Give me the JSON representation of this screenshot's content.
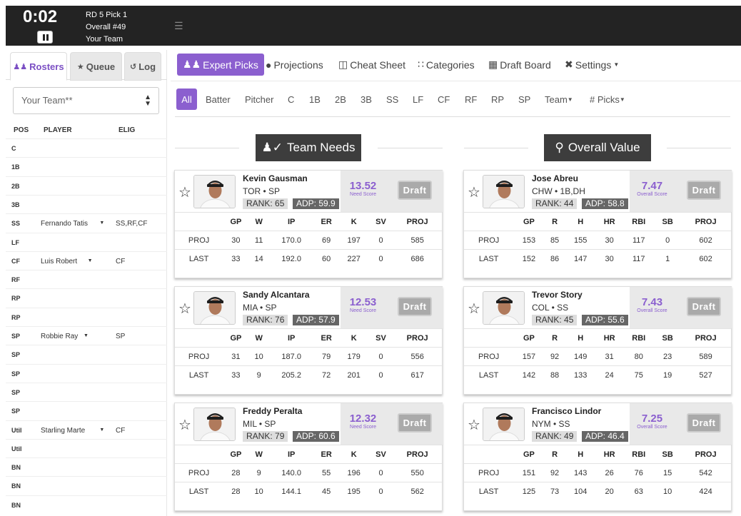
{
  "header": {
    "clock": "0:02",
    "pick_line1": "RD 5 Pick 1",
    "pick_line2": "Overall #49",
    "pick_line3": "Your Team"
  },
  "left_tabs": [
    {
      "label": "Rosters",
      "icon": "users-icon"
    },
    {
      "label": "Queue",
      "icon": "star-icon"
    },
    {
      "label": "Log",
      "icon": "history-icon"
    }
  ],
  "team_select": {
    "value": "Your Team**"
  },
  "roster_headers": {
    "pos": "POS",
    "player": "PLAYER",
    "elig": "ELIG"
  },
  "roster": [
    {
      "pos": "C",
      "player": "",
      "elig": ""
    },
    {
      "pos": "1B",
      "player": "",
      "elig": ""
    },
    {
      "pos": "2B",
      "player": "",
      "elig": ""
    },
    {
      "pos": "3B",
      "player": "",
      "elig": ""
    },
    {
      "pos": "SS",
      "player": "Fernando Tatis",
      "elig": "SS,RF,CF"
    },
    {
      "pos": "LF",
      "player": "",
      "elig": ""
    },
    {
      "pos": "CF",
      "player": "Luis Robert",
      "elig": "CF"
    },
    {
      "pos": "RF",
      "player": "",
      "elig": ""
    },
    {
      "pos": "RP",
      "player": "",
      "elig": ""
    },
    {
      "pos": "RP",
      "player": "",
      "elig": ""
    },
    {
      "pos": "SP",
      "player": "Robbie Ray",
      "elig": "SP"
    },
    {
      "pos": "SP",
      "player": "",
      "elig": ""
    },
    {
      "pos": "SP",
      "player": "",
      "elig": ""
    },
    {
      "pos": "SP",
      "player": "",
      "elig": ""
    },
    {
      "pos": "SP",
      "player": "",
      "elig": ""
    },
    {
      "pos": "Util",
      "player": "Starling Marte",
      "elig": "CF"
    },
    {
      "pos": "Util",
      "player": "",
      "elig": ""
    },
    {
      "pos": "BN",
      "player": "",
      "elig": ""
    },
    {
      "pos": "BN",
      "player": "",
      "elig": ""
    },
    {
      "pos": "BN",
      "player": "",
      "elig": ""
    }
  ],
  "nav": [
    {
      "label": "Expert Picks",
      "icon": "users-icon"
    },
    {
      "label": "Projections",
      "icon": "lightbulb-icon"
    },
    {
      "label": "Cheat Sheet",
      "icon": "copy-icon"
    },
    {
      "label": "Categories",
      "icon": "grid-icon"
    },
    {
      "label": "Draft Board",
      "icon": "table-icon"
    },
    {
      "label": "Settings",
      "icon": "wrench-icon"
    }
  ],
  "filters": [
    "All",
    "Batter",
    "Pitcher",
    "C",
    "1B",
    "2B",
    "3B",
    "SS",
    "LF",
    "CF",
    "RF",
    "RP",
    "SP",
    "Team",
    "# Picks"
  ],
  "sections": {
    "team_needs": "Team Needs",
    "overall_value": "Overall Value"
  },
  "draft_label": "Draft",
  "rank_prefix": "RANK:",
  "adp_prefix": "ADP:",
  "team_needs_cards": [
    {
      "name": "Kevin Gausman",
      "team": "TOR • SP",
      "rank": "65",
      "adp": "59.9",
      "score": "13.52",
      "score_label": "Need Score",
      "headers": [
        "",
        "GP",
        "W",
        "IP",
        "ER",
        "K",
        "SV",
        "PROJ"
      ],
      "rows": [
        [
          "PROJ",
          "30",
          "11",
          "170.0",
          "69",
          "197",
          "0",
          "585"
        ],
        [
          "LAST",
          "33",
          "14",
          "192.0",
          "60",
          "227",
          "0",
          "686"
        ]
      ]
    },
    {
      "name": "Sandy Alcantara",
      "team": "MIA • SP",
      "rank": "76",
      "adp": "57.9",
      "score": "12.53",
      "score_label": "Need Score",
      "headers": [
        "",
        "GP",
        "W",
        "IP",
        "ER",
        "K",
        "SV",
        "PROJ"
      ],
      "rows": [
        [
          "PROJ",
          "31",
          "10",
          "187.0",
          "79",
          "179",
          "0",
          "556"
        ],
        [
          "LAST",
          "33",
          "9",
          "205.2",
          "72",
          "201",
          "0",
          "617"
        ]
      ]
    },
    {
      "name": "Freddy Peralta",
      "team": "MIL • SP",
      "rank": "79",
      "adp": "60.6",
      "score": "12.32",
      "score_label": "Need Score",
      "headers": [
        "",
        "GP",
        "W",
        "IP",
        "ER",
        "K",
        "SV",
        "PROJ"
      ],
      "rows": [
        [
          "PROJ",
          "28",
          "9",
          "140.0",
          "55",
          "196",
          "0",
          "550"
        ],
        [
          "LAST",
          "28",
          "10",
          "144.1",
          "45",
          "195",
          "0",
          "562"
        ]
      ]
    }
  ],
  "overall_value_cards": [
    {
      "name": "Jose Abreu",
      "team": "CHW • 1B,DH",
      "rank": "44",
      "adp": "58.8",
      "score": "7.47",
      "score_label": "Overall Score",
      "headers": [
        "",
        "GP",
        "R",
        "H",
        "HR",
        "RBI",
        "SB",
        "PROJ"
      ],
      "rows": [
        [
          "PROJ",
          "153",
          "85",
          "155",
          "30",
          "117",
          "0",
          "602"
        ],
        [
          "LAST",
          "152",
          "86",
          "147",
          "30",
          "117",
          "1",
          "602"
        ]
      ]
    },
    {
      "name": "Trevor Story",
      "team": "COL • SS",
      "rank": "45",
      "adp": "55.6",
      "score": "7.43",
      "score_label": "Overall Score",
      "headers": [
        "",
        "GP",
        "R",
        "H",
        "HR",
        "RBI",
        "SB",
        "PROJ"
      ],
      "rows": [
        [
          "PROJ",
          "157",
          "92",
          "149",
          "31",
          "80",
          "23",
          "589"
        ],
        [
          "LAST",
          "142",
          "88",
          "133",
          "24",
          "75",
          "19",
          "527"
        ]
      ]
    },
    {
      "name": "Francisco Lindor",
      "team": "NYM • SS",
      "rank": "49",
      "adp": "46.4",
      "score": "7.25",
      "score_label": "Overall Score",
      "headers": [
        "",
        "GP",
        "R",
        "H",
        "HR",
        "RBI",
        "SB",
        "PROJ"
      ],
      "rows": [
        [
          "PROJ",
          "151",
          "92",
          "143",
          "26",
          "76",
          "15",
          "542"
        ],
        [
          "LAST",
          "125",
          "73",
          "104",
          "20",
          "63",
          "10",
          "424"
        ]
      ]
    }
  ],
  "colors": {
    "accent": "#8b5fcf",
    "topbar": "#232323",
    "section_header": "#3d3d3d",
    "draft_button": "#aaaaaa"
  }
}
